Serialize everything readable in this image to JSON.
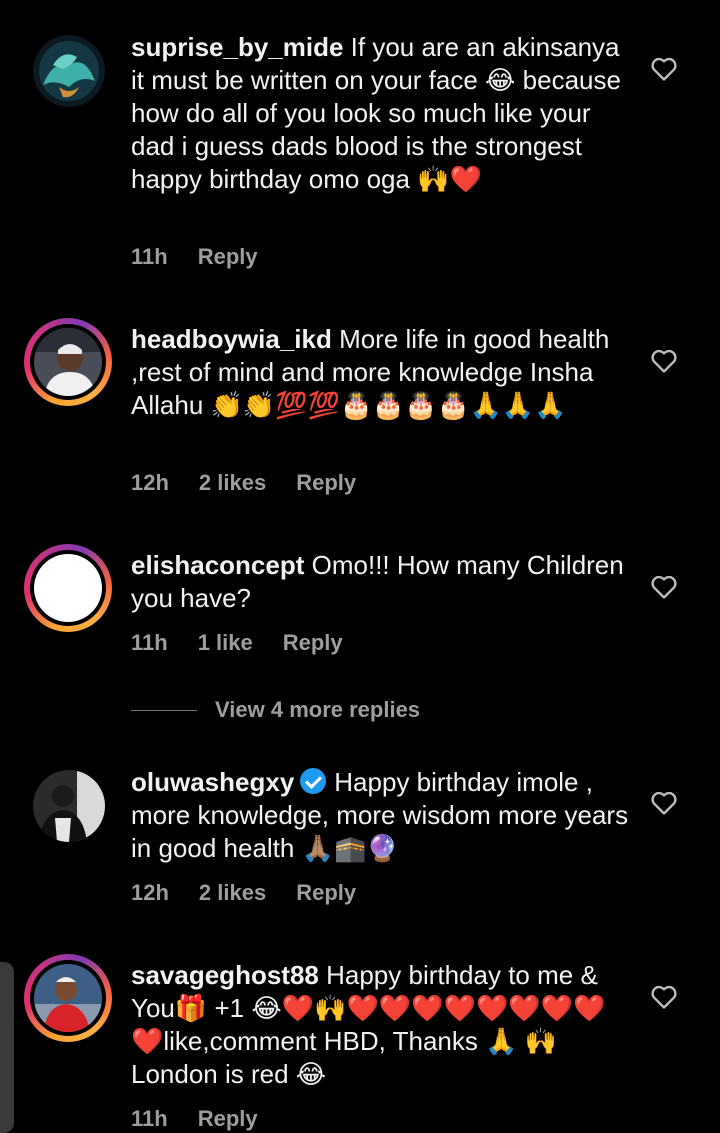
{
  "comments": [
    {
      "username": "suprise_by_mide",
      "text": " If you are an akinsanya it must be written on your face 😂 because how do all of you look so much like your dad i guess dads blood is the strongest happy birthday omo oga 🙌❤️",
      "time": "11h",
      "likes": "",
      "reply": "Reply"
    },
    {
      "username": "headboywia_ikd",
      "text": " More life in good health ,rest of mind and more knowledge Insha Allahu 👏👏💯💯🎂🎂🎂🎂🙏🙏🙏",
      "time": "12h",
      "likes": "2 likes",
      "reply": "Reply"
    },
    {
      "username": "elishaconcept",
      "text": " Omo!!! How many Children you have?",
      "time": "11h",
      "likes": "1 like",
      "reply": "Reply"
    },
    {
      "username": "oluwashegxy",
      "text": "Happy birthday imole , more knowledge, more wisdom more years in good health 🙏🏽🕋🔮",
      "time": "12h",
      "likes": "2 likes",
      "reply": "Reply"
    },
    {
      "username": "savageghost88",
      "text": " Happy birthday to me & You🎁 +1 😂❤️🙌❤️❤️❤️❤️❤️❤️❤️❤️❤️like,comment HBD, Thanks 🙏 🙌 London is red 😂",
      "time": "11h",
      "likes": "",
      "reply": "Reply"
    }
  ],
  "view_more_replies": "View 4 more replies",
  "icons": {
    "like": "heart-outline-icon",
    "verified": "verified-badge-icon"
  },
  "colors": {
    "background": "#000000",
    "muted_text": "#9e9e9e",
    "verified": "#1d9bf0"
  }
}
